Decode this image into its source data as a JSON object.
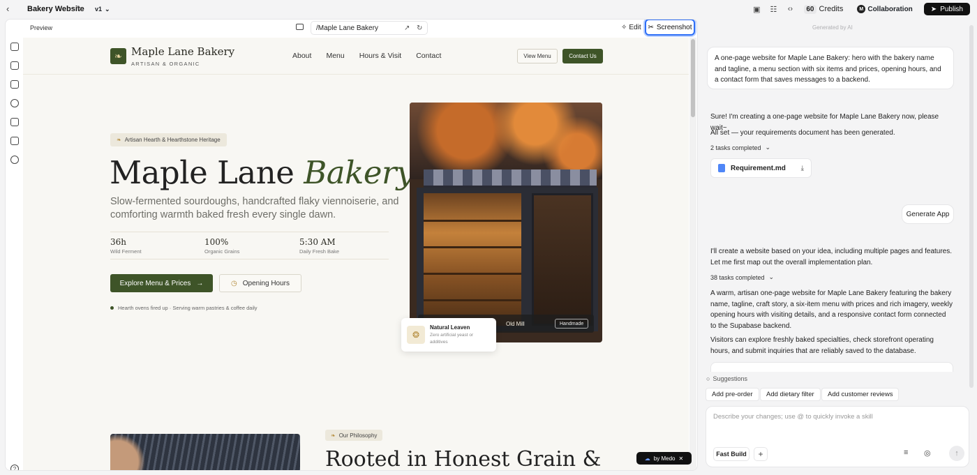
{
  "app": {
    "project_title": "Bakery Website",
    "version": "v1",
    "credits": "60",
    "credits_label": "Credits",
    "collab_initial": "M",
    "collab_label": "Collaboration",
    "publish_label": "Publish"
  },
  "preview": {
    "label": "Preview",
    "url": "/Maple Lane Bakery",
    "edit_label": "Edit",
    "screenshot_label": "Screenshot",
    "badge_label": "by Medo"
  },
  "site": {
    "brand_name": "Maple Lane Bakery",
    "brand_tagline": "ARTISAN & ORGANIC",
    "nav": [
      "About",
      "Menu",
      "Hours & Visit",
      "Contact"
    ],
    "view_menu": "View Menu",
    "contact_us": "Contact Us",
    "hero_badge": "Artisan Hearth & Hearthstone Heritage",
    "hero_title_main": "Maple Lane",
    "hero_title_italic": "Bakery",
    "hero_subtitle": "Slow-fermented sourdoughs, handcrafted flaky viennoiserie, and comforting warmth baked fresh every single dawn.",
    "stats": [
      {
        "value": "36h",
        "label": "Wild Ferment"
      },
      {
        "value": "100%",
        "label": "Organic Grains"
      },
      {
        "value": "5:30 AM",
        "label": "Daily Fresh Bake"
      }
    ],
    "cta_primary": "Explore Menu & Prices",
    "cta_secondary": "Opening Hours",
    "status_note": "Hearth ovens fired up · Serving warm pastries & coffee daily",
    "photo_caption": "Old Mill",
    "photo_chip": "Handmade",
    "leaven_title": "Natural Leaven",
    "leaven_desc": "Zero artificial yeast or additives",
    "section_badge": "Our Philosophy",
    "section_title": "Rooted in Honest Grain &"
  },
  "chat": {
    "generated_by": "Generated by AI",
    "user_message": "A one-page website for Maple Lane Bakery: hero with the bakery name and tagline, a menu section with six items and prices, opening hours, and a contact form that saves messages to a backend.",
    "ai_reply_1": "Sure! I'm creating a one-page website for Maple Lane Bakery now, please wait~",
    "ai_reply_2": "All set — your requirements document has been generated.",
    "tasks_1": "2 tasks completed",
    "file_name": "Requirement.md",
    "generate_app": "Generate App",
    "ai_reply_3": "I'll create a website based on your idea, including multiple pages and features. Let me first map out the overall implementation plan.",
    "tasks_2": "38 tasks completed",
    "ai_reply_4": "A warm, artisan one-page website for Maple Lane Bakery featuring the bakery name, tagline, craft story, a six-item menu with prices and rich imagery, weekly opening hours with visiting details, and a responsive contact form connected to the Supabase backend.",
    "ai_reply_5": "Visitors can explore freshly baked specialties, check storefront operating hours, and submit inquiries that are reliably saved to the database.",
    "suggestions_label": "Suggestions",
    "suggestions": [
      "Add pre-order",
      "Add dietary filter",
      "Add customer reviews"
    ],
    "composer_placeholder": "Describe your changes; use @ to quickly invoke a skill",
    "fast_build": "Fast Build"
  },
  "colors": {
    "brand_green": "#3e5428",
    "accent_blue": "#2d6ef7"
  }
}
